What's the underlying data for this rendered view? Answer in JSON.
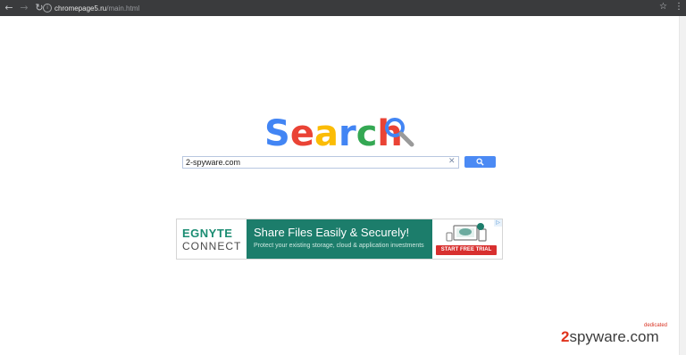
{
  "browser": {
    "url_host": "chromepage5.ru",
    "url_path": "/main.html",
    "icons": {
      "back": "arrow-left-icon",
      "forward": "arrow-right-icon",
      "reload": "reload-icon",
      "bookmark": "star-icon",
      "menu": "kebab-menu-icon"
    }
  },
  "search": {
    "logo_letters": [
      "S",
      "e",
      "a",
      "r",
      "c",
      "h"
    ],
    "logo_colors": [
      "#4285f4",
      "#ea4335",
      "#fbbc05",
      "#4285f4",
      "#34a853",
      "#ea4335"
    ],
    "query": "2-spyware.com",
    "clear_label": "✕"
  },
  "ad": {
    "brand_top": "EGNYTE",
    "brand_bottom": "CONNECT",
    "headline": "Share Files Easily & Securely!",
    "subtext": "Protect your existing storage, cloud & application investments",
    "cta": "START FREE TRIAL",
    "adchoices": "▷"
  },
  "watermark": {
    "prefix": "2",
    "name": "spyware",
    "suffix": ".com",
    "tag": "dedicated"
  },
  "colors": {
    "chrome": "#3a3b3d",
    "search_button": "#4b8af4",
    "ad_green": "#1c7d6b",
    "cta_red": "#d8302f"
  }
}
